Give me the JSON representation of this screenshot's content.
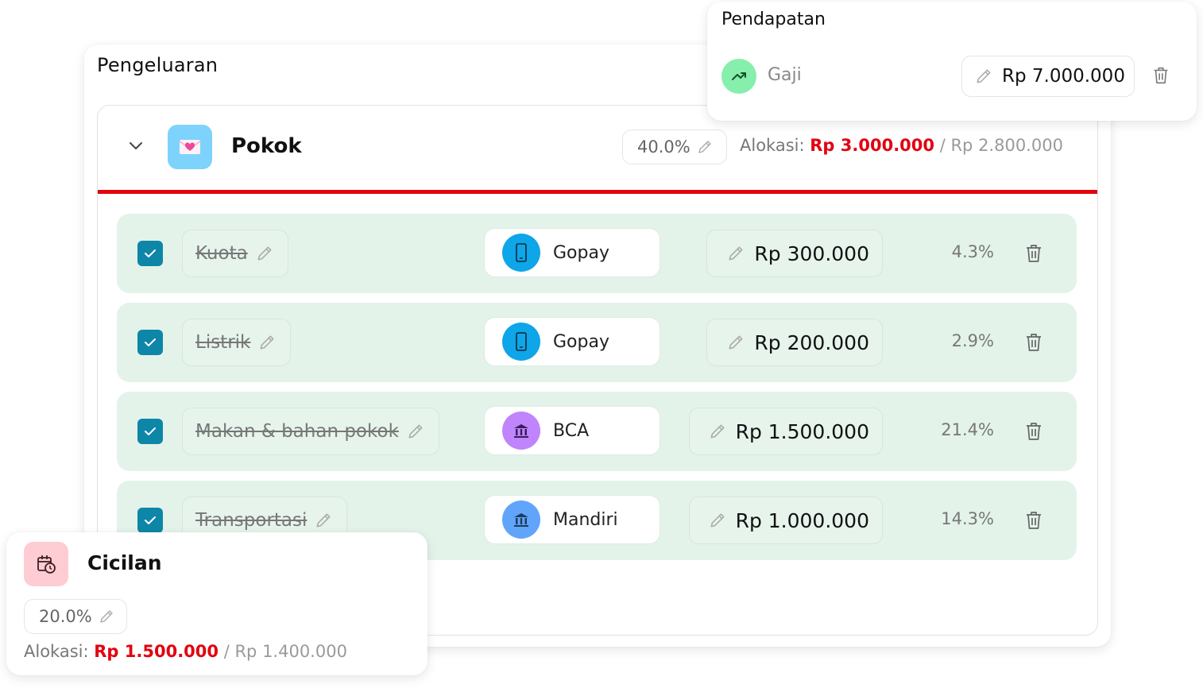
{
  "expenses": {
    "title": "Pengeluaran",
    "category": {
      "name": "Pokok",
      "percent": "40.0%",
      "allocation_label": "Alokasi:",
      "allocation_value": "Rp 3.000.000",
      "separator": "/",
      "spent_value": "Rp 2.800.000",
      "icon": "envelope-heart-icon",
      "icon_bg": "#7dd3fc",
      "over_budget_color": "#e3000f"
    },
    "items": [
      {
        "name": "Kuota",
        "checked": true,
        "account": "Gopay",
        "account_icon": "phone-icon",
        "account_color": "#0ea5e9",
        "amount": "Rp 300.000",
        "percent": "4.3%"
      },
      {
        "name": "Listrik",
        "checked": true,
        "account": "Gopay",
        "account_icon": "phone-icon",
        "account_color": "#0ea5e9",
        "amount": "Rp 200.000",
        "percent": "2.9%"
      },
      {
        "name": "Makan & bahan pokok",
        "checked": true,
        "account": "BCA",
        "account_icon": "bank-icon",
        "account_color": "#c084fc",
        "amount": "Rp 1.500.000",
        "percent": "21.4%"
      },
      {
        "name": "Transportasi",
        "checked": true,
        "account": "Mandiri",
        "account_icon": "bank-icon",
        "account_color": "#60a5fa",
        "amount": "Rp 1.000.000",
        "percent": "14.3%"
      }
    ]
  },
  "income": {
    "title": "Pendapatan",
    "items": [
      {
        "name": "Gaji",
        "amount": "Rp 7.000.000",
        "icon": "trending-up-icon",
        "icon_bg": "#86efac"
      }
    ]
  },
  "installments": {
    "name": "Cicilan",
    "percent": "20.0%",
    "allocation_label": "Alokasi:",
    "allocation_value": "Rp 1.500.000",
    "separator": "/",
    "spent_value": "Rp 1.400.000",
    "icon": "calendar-clock-icon",
    "icon_bg": "#fecdd3"
  }
}
